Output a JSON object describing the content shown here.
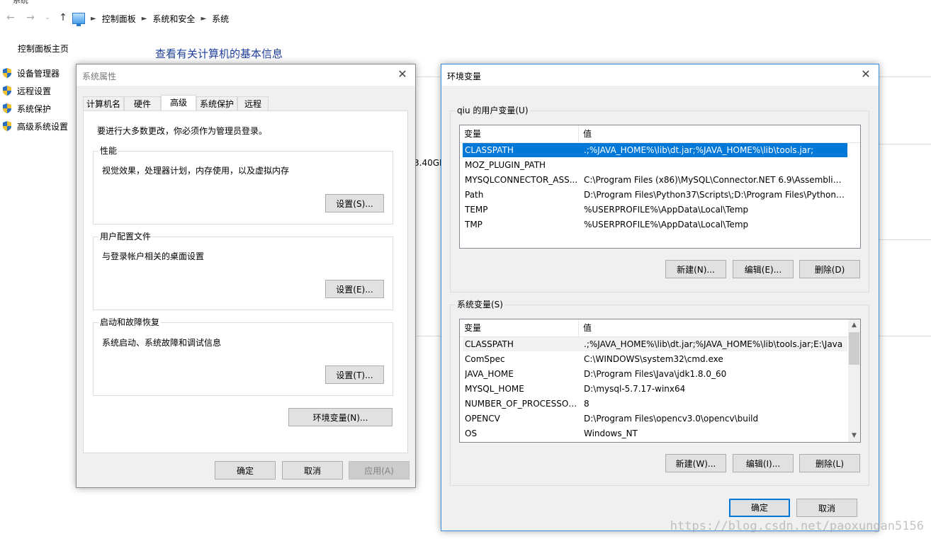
{
  "window": {
    "title_fragment": "系统"
  },
  "address_bar": {
    "crumbs": [
      "控制面板",
      "系统和安全",
      "系统"
    ]
  },
  "left_nav": {
    "home": "控制面板主页",
    "items": [
      "设备管理器",
      "远程设置",
      "系统保护",
      "高级系统设置"
    ]
  },
  "main": {
    "heading": "查看有关计算机的基本信息",
    "cpu_fragment": "3.40GH"
  },
  "system_properties": {
    "title": "系统属性",
    "tabs": [
      "计算机名",
      "硬件",
      "高级",
      "系统保护",
      "远程"
    ],
    "active_tab": "高级",
    "admin_note": "要进行大多数更改，你必须作为管理员登录。",
    "performance": {
      "label": "性能",
      "desc": "视觉效果，处理器计划，内存使用，以及虚拟内存",
      "button": "设置(S)..."
    },
    "user_profiles": {
      "label": "用户配置文件",
      "desc": "与登录帐户相关的桌面设置",
      "button": "设置(E)..."
    },
    "startup_recovery": {
      "label": "启动和故障恢复",
      "desc": "系统启动、系统故障和调试信息",
      "button": "设置(T)..."
    },
    "env_button": "环境变量(N)...",
    "ok": "确定",
    "cancel": "取消",
    "apply": "应用(A)"
  },
  "environment_variables": {
    "title": "环境变量",
    "user_group_label": "qiu 的用户变量(U)",
    "col_name": "变量",
    "col_value": "值",
    "user_vars": [
      {
        "name": "CLASSPATH",
        "value": ".;%JAVA_HOME%\\lib\\dt.jar;%JAVA_HOME%\\lib\\tools.jar;"
      },
      {
        "name": "MOZ_PLUGIN_PATH",
        "value": ""
      },
      {
        "name": "MYSQLCONNECTOR_ASS...",
        "value": "C:\\Program Files (x86)\\MySQL\\Connector.NET 6.9\\Assemblies..."
      },
      {
        "name": "Path",
        "value": "D:\\Program Files\\Python37\\Scripts\\;D:\\Program Files\\Python3..."
      },
      {
        "name": "TEMP",
        "value": "%USERPROFILE%\\AppData\\Local\\Temp"
      },
      {
        "name": "TMP",
        "value": "%USERPROFILE%\\AppData\\Local\\Temp"
      }
    ],
    "user_buttons": {
      "new": "新建(N)...",
      "edit": "编辑(E)...",
      "delete": "删除(D)"
    },
    "system_group_label": "系统变量(S)",
    "system_vars": [
      {
        "name": "CLASSPATH",
        "value": ".;%JAVA_HOME%\\lib\\dt.jar;%JAVA_HOME%\\lib\\tools.jar;E:\\Java"
      },
      {
        "name": "ComSpec",
        "value": "C:\\WINDOWS\\system32\\cmd.exe"
      },
      {
        "name": "JAVA_HOME",
        "value": "D:\\Program Files\\Java\\jdk1.8.0_60"
      },
      {
        "name": "MYSQL_HOME",
        "value": "D:\\mysql-5.7.17-winx64"
      },
      {
        "name": "NUMBER_OF_PROCESSORS",
        "value": "8"
      },
      {
        "name": "OPENCV",
        "value": "D:\\Program Files\\opencv3.0\\opencv\\build"
      },
      {
        "name": "OS",
        "value": "Windows_NT"
      }
    ],
    "system_buttons": {
      "new": "新建(W)...",
      "edit": "编辑(I)...",
      "delete": "删除(L)"
    },
    "ok": "确定",
    "cancel": "取消"
  },
  "watermark": "https://blog.csdn.net/paoxungan5156",
  "colors": {
    "selection": "#0078d7",
    "heading": "#1e3e9c",
    "dialog_bg": "#f0f0f0"
  }
}
